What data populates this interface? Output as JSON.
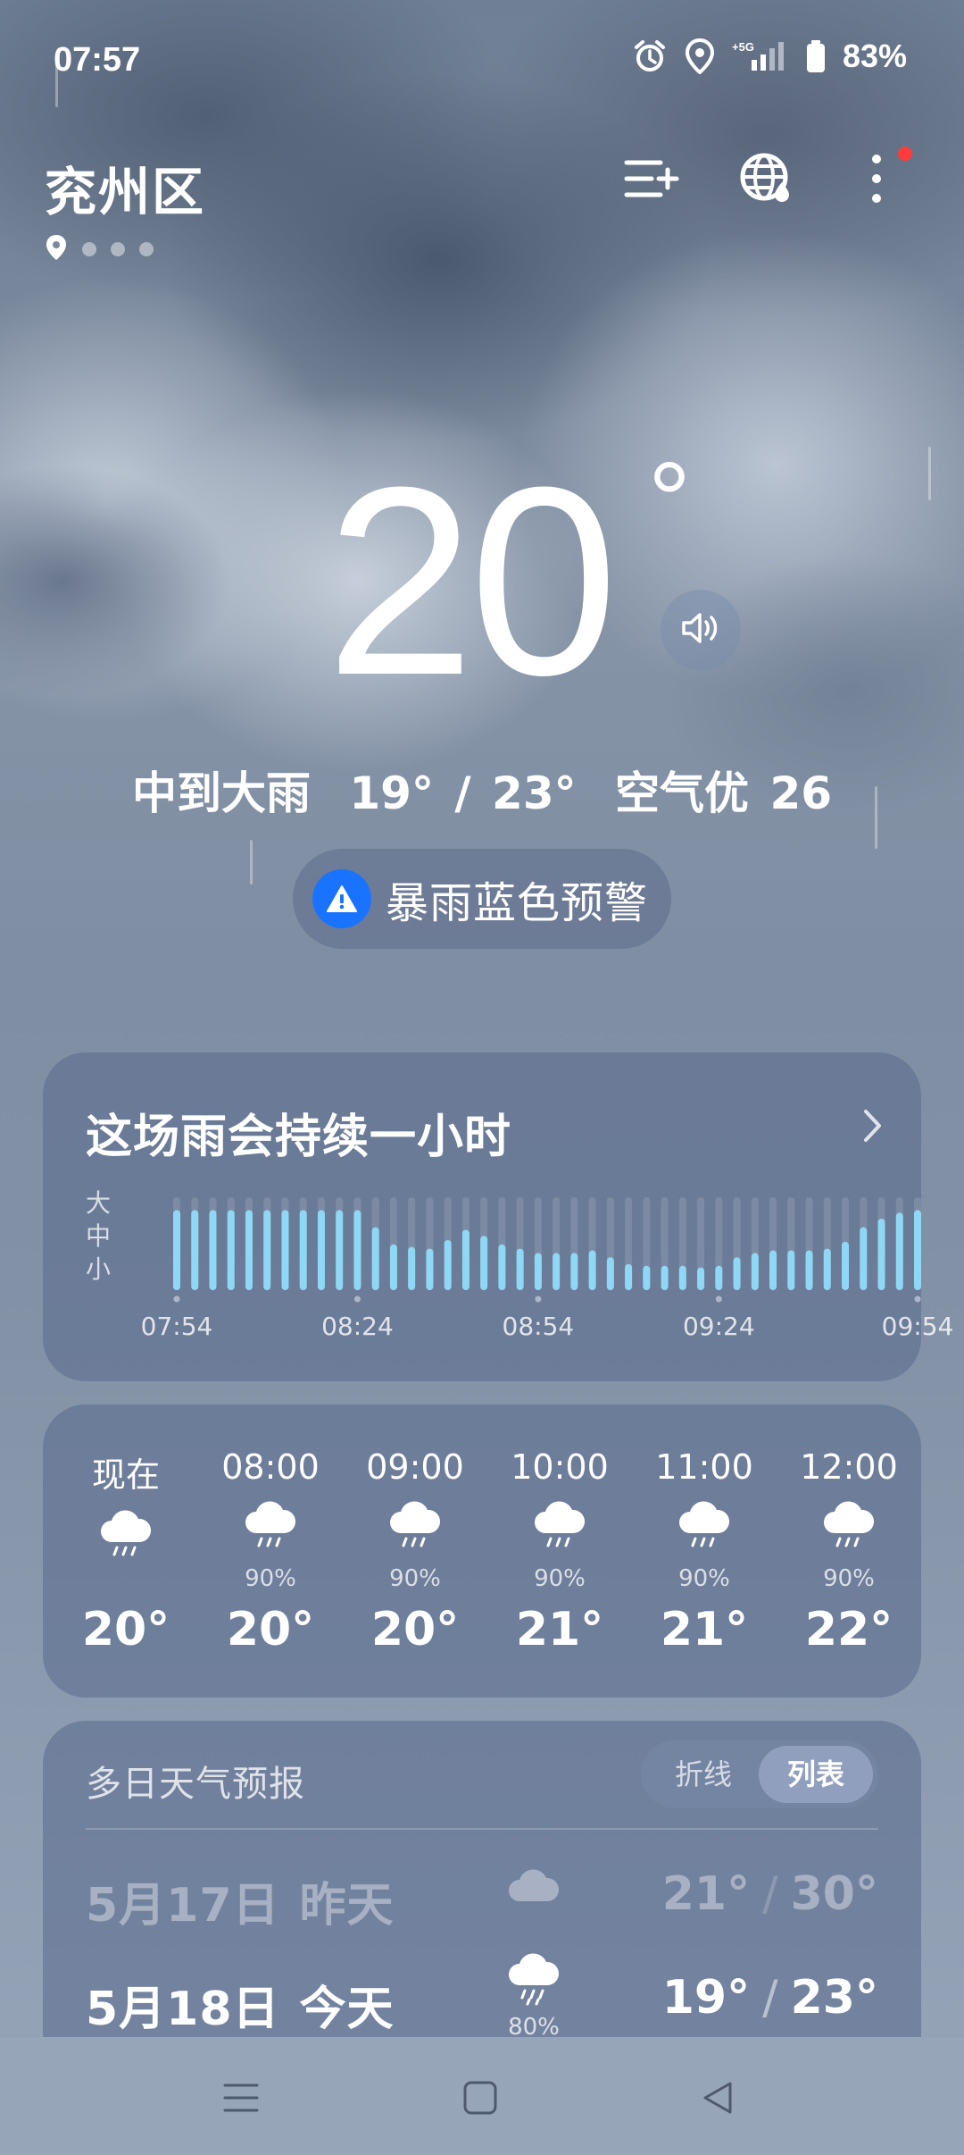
{
  "status_bar": {
    "time": "07:57",
    "network": "5G",
    "battery": "83%",
    "icons": [
      "alarm-icon",
      "location-icon",
      "signal-icon",
      "battery-icon"
    ]
  },
  "header": {
    "city": "兖州区",
    "page_count": 4,
    "actions": [
      "add-city-icon",
      "globe-icon",
      "more-icon"
    ],
    "notification_dot_color": "#ff3b3b"
  },
  "current": {
    "temperature": "20",
    "degree_symbol": "°",
    "condition": "中到大雨",
    "range": "19° / 23°",
    "air_quality": "空气优 26",
    "alert": "暴雨蓝色预警",
    "alert_color": "#1a73ff"
  },
  "rain_card": {
    "title": "这场雨会持续一小时",
    "levels": [
      "大",
      "中",
      "小"
    ],
    "times": [
      "07:54",
      "08:24",
      "08:54",
      "09:24",
      "09:54"
    ],
    "intensity": [
      0.85,
      0.85,
      0.85,
      0.85,
      0.85,
      0.85,
      0.85,
      0.85,
      0.85,
      0.85,
      0.85,
      0.65,
      0.45,
      0.42,
      0.4,
      0.5,
      0.62,
      0.55,
      0.45,
      0.4,
      0.35,
      0.35,
      0.35,
      0.38,
      0.3,
      0.22,
      0.2,
      0.2,
      0.2,
      0.18,
      0.2,
      0.3,
      0.35,
      0.38,
      0.38,
      0.38,
      0.4,
      0.48,
      0.65,
      0.75,
      0.82,
      0.85
    ],
    "bar_color": "#8fd8f5"
  },
  "hourly": [
    {
      "time": "现在",
      "pop": "",
      "temp": "20°"
    },
    {
      "time": "08:00",
      "pop": "90%",
      "temp": "20°"
    },
    {
      "time": "09:00",
      "pop": "90%",
      "temp": "20°"
    },
    {
      "time": "10:00",
      "pop": "90%",
      "temp": "21°"
    },
    {
      "time": "11:00",
      "pop": "90%",
      "temp": "21°"
    },
    {
      "time": "12:00",
      "pop": "90%",
      "temp": "22°"
    }
  ],
  "forecast": {
    "title": "多日天气预报",
    "toggle": {
      "line": "折线",
      "list": "列表",
      "selected": "列表"
    },
    "days": [
      {
        "date": "5月17日",
        "day": "昨天",
        "icon": "cloud-icon",
        "pop": "",
        "low": "21°",
        "high": "30°"
      },
      {
        "date": "5月18日",
        "day": "今天",
        "icon": "rain-cloud-icon",
        "pop": "80%",
        "low": "19°",
        "high": "23°"
      }
    ],
    "separator": "/"
  },
  "nav": [
    "menu-icon",
    "home-icon",
    "back-icon"
  ]
}
